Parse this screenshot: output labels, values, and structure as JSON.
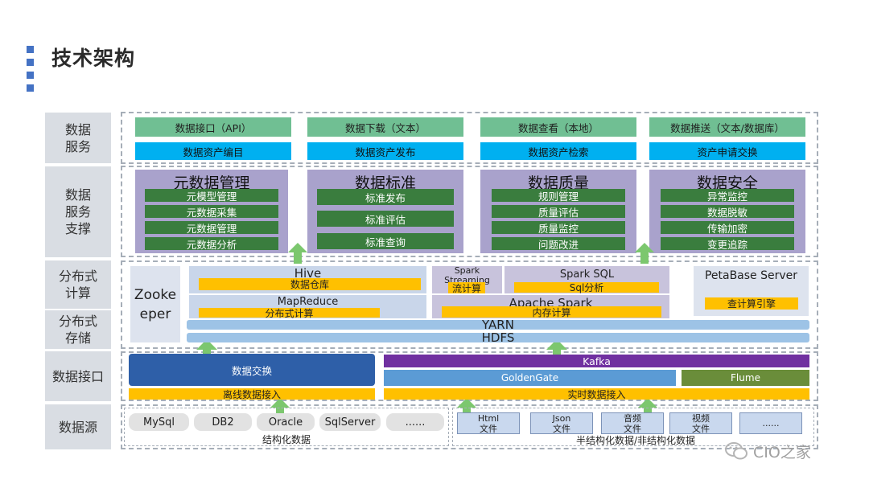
{
  "page_title": "技术架构",
  "layers": {
    "data_service": "数据\n服务",
    "data_support": "数据\n服务\n支撑",
    "distributed_compute": "分布式\n计算",
    "distributed_storage": "分布式\n存储",
    "data_interface": "数据接口",
    "data_source": "数据源"
  },
  "service": {
    "top": [
      "数据接口（API）",
      "数据下载（文本）",
      "数据查看（本地）",
      "数据推送（文本/数据库）"
    ],
    "bottom": [
      "数据资产编目",
      "数据资产发布",
      "数据资产检索",
      "资产申请交换"
    ]
  },
  "support": {
    "metadata": {
      "title": "元数据管理",
      "items": [
        "元模型管理",
        "元数据采集",
        "元数据管理",
        "元数据分析"
      ]
    },
    "standard": {
      "title": "数据标准",
      "items": [
        "标准发布",
        "标准评估",
        "标准查询"
      ]
    },
    "quality": {
      "title": "数据质量",
      "items": [
        "规则管理",
        "质量评估",
        "质量监控",
        "问题改进"
      ]
    },
    "security": {
      "title": "数据安全",
      "items": [
        "异常监控",
        "数据脱敏",
        "传输加密",
        "变更追踪"
      ]
    }
  },
  "compute": {
    "zookeeper": "Zooke\neper",
    "hive": "Hive",
    "hive_sub": "数据仓库",
    "spark_streaming": "Spark\nStreaming",
    "spark_streaming_sub": "流计算",
    "spark_sql": "Spark SQL",
    "spark_sql_sub": "Sql分析",
    "petabase": "PetaBase Server",
    "petabase_sub": "查计算引擎",
    "mapreduce": "MapReduce",
    "mapreduce_sub": "分布式计算",
    "apache_spark": "Apache Spark",
    "apache_spark_sub": "内存计算",
    "yarn": "YARN",
    "hdfs": "HDFS"
  },
  "interface": {
    "exchange": "数据交换",
    "offline": "离线数据接入",
    "kafka": "Kafka",
    "goldengate": "GoldenGate",
    "flume": "Flume",
    "realtime": "实时数据接入"
  },
  "sources": {
    "structured": [
      "MySql",
      "DB2",
      "Oracle",
      "SqlServer",
      "......"
    ],
    "structured_label": "结构化数据",
    "semi": [
      "Html\n文件",
      "Json\n文件",
      "音频\n文件",
      "视频\n文件",
      "......"
    ],
    "semi_label": "半结构化数据/非结构化数据"
  },
  "watermark": "CIO之家",
  "colors": {
    "accent": "#4472c4",
    "green": "#70bf93",
    "blue": "#00b0f0",
    "purple": "#a9a2cc",
    "dark_green": "#3a7d3e",
    "yellow": "#ffc000",
    "navy": "#2e5fa8",
    "violet": "#7030a0"
  }
}
